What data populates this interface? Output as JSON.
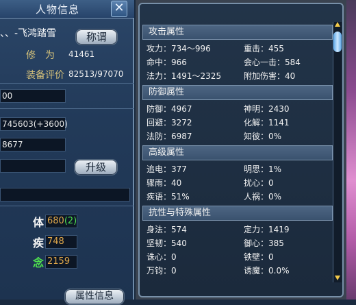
{
  "window": {
    "title": "人物信息",
    "close_glyph": "✕"
  },
  "character": {
    "name": "、、-飞鸿踏雪",
    "title_button": "称谓",
    "cultivation_label": "修　为",
    "cultivation_value": "41461",
    "equip_rating_label": "装备评价",
    "equip_rating_value": "82513/97070"
  },
  "fields": {
    "box1": "00",
    "box2": "745603(+3600)",
    "box3": "8677",
    "box4": "",
    "box5": ""
  },
  "upgrade_button": "升级",
  "stats": [
    {
      "label": "体",
      "value": "680",
      "bonus": "(2)"
    },
    {
      "label": "疾",
      "value": "748",
      "bonus": ""
    },
    {
      "label": "念",
      "value": "2159",
      "bonus": ""
    }
  ],
  "attr_info_button": "属性信息",
  "sections": {
    "attack": {
      "header": "攻击属性",
      "rows": [
        [
          "攻力：734～996",
          "重击：455"
        ],
        [
          "命中：966",
          "会心一击：584"
        ],
        [
          "法力：1491～2325",
          "附加伤害：40"
        ]
      ]
    },
    "defense": {
      "header": "防御属性",
      "rows": [
        [
          "防御：4967",
          "神明：2430"
        ],
        [
          "回避：3272",
          "化解：1141"
        ],
        [
          "法防：6987",
          "知彼：0%"
        ]
      ]
    },
    "advanced": {
      "header": "高级属性",
      "rows": [
        [
          "追电：377",
          "明思：1%"
        ],
        [
          "骤雨：40",
          "扰心：0"
        ],
        [
          "疾语：51%",
          "人祸：0%"
        ]
      ]
    },
    "resist": {
      "header": "抗性与特殊属性",
      "rows": [
        [
          "身法：574",
          "定力：1419"
        ],
        [
          "坚韧：540",
          "御心：385"
        ],
        [
          "诛心：0",
          "铁壁：0"
        ],
        [
          "万钧：0",
          "诱魔：0.0%"
        ]
      ]
    }
  },
  "colors": {
    "stat_value": "#e0a84b",
    "bonus": "#4fe04f",
    "label_gold": "#d6c27a"
  }
}
